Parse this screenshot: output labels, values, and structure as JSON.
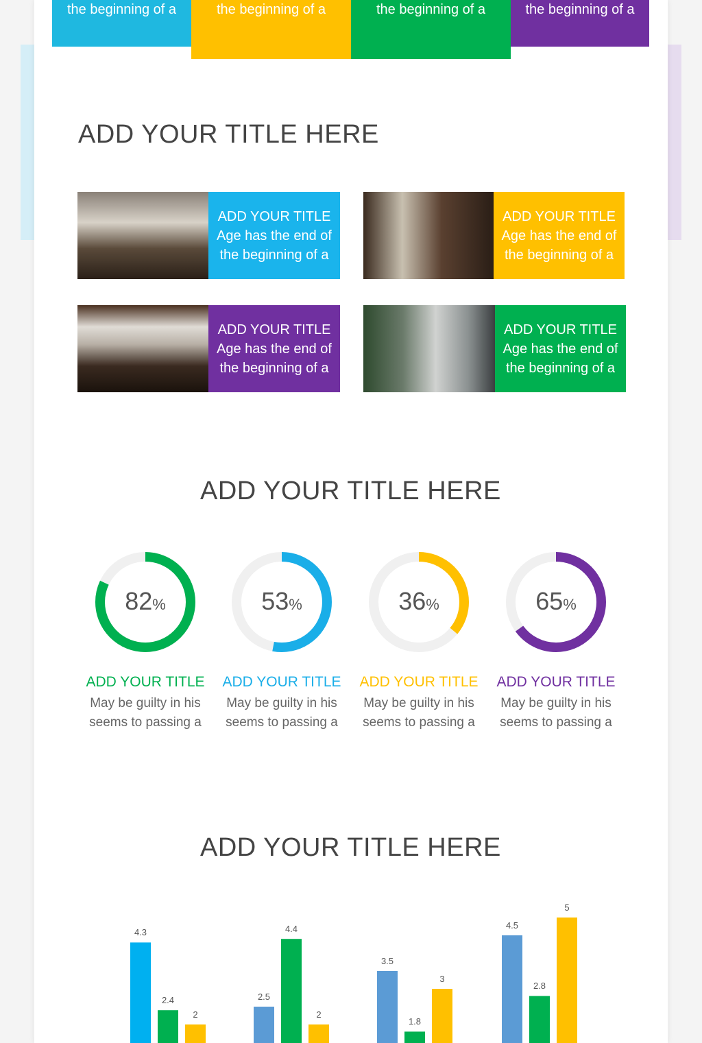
{
  "colors": {
    "cyan": "#1fb8e0",
    "yellow": "#ffc000",
    "green": "#00b050",
    "purple": "#7030a0",
    "blue": "#00b0f0",
    "steel": "#5b9bd5"
  },
  "top_blocks": [
    "the beginning of a",
    "the beginning of a",
    "the beginning of a",
    "the beginning of a"
  ],
  "section1": {
    "title": "ADD YOUR TITLE HERE",
    "cards": [
      {
        "title": "ADD YOUR TITLE",
        "line1": "Age has the end of",
        "line2": "the beginning of a"
      },
      {
        "title": "ADD YOUR TITLE",
        "line1": "Age has the end of",
        "line2": "the beginning of a"
      },
      {
        "title": "ADD YOUR TITLE",
        "line1": "Age has the end of",
        "line2": "the beginning of a"
      },
      {
        "title": "ADD YOUR TITLE",
        "line1": "Age has the end of",
        "line2": "the beginning of a"
      }
    ]
  },
  "section2": {
    "title": "ADD YOUR TITLE HERE",
    "donuts": [
      {
        "value": 82,
        "unit": "%",
        "title": "ADD YOUR TITLE",
        "line1": "May be guilty in his",
        "line2": "seems to passing a"
      },
      {
        "value": 53,
        "unit": "%",
        "title": "ADD YOUR TITLE",
        "line1": "May be guilty in his",
        "line2": "seems to passing a"
      },
      {
        "value": 36,
        "unit": "%",
        "title": "ADD YOUR TITLE",
        "line1": "May be guilty in his",
        "line2": "seems to passing a"
      },
      {
        "value": 65,
        "unit": "%",
        "title": "ADD YOUR TITLE",
        "line1": "May be guilty in his",
        "line2": "seems to passing a"
      }
    ]
  },
  "section3": {
    "title": "ADD YOUR TITLE HERE"
  },
  "chart_data": {
    "type": "bar",
    "groups": [
      [
        4.3,
        2.4,
        2
      ],
      [
        2.5,
        4.4,
        2
      ],
      [
        3.5,
        1.8,
        3
      ],
      [
        4.5,
        2.8,
        5
      ]
    ],
    "labels": [
      [
        "4.3",
        "2.4",
        "2"
      ],
      [
        "2.5",
        "4.4",
        "2"
      ],
      [
        "3.5",
        "1.8",
        "3"
      ],
      [
        "4.5",
        "2.8",
        "5"
      ]
    ]
  }
}
